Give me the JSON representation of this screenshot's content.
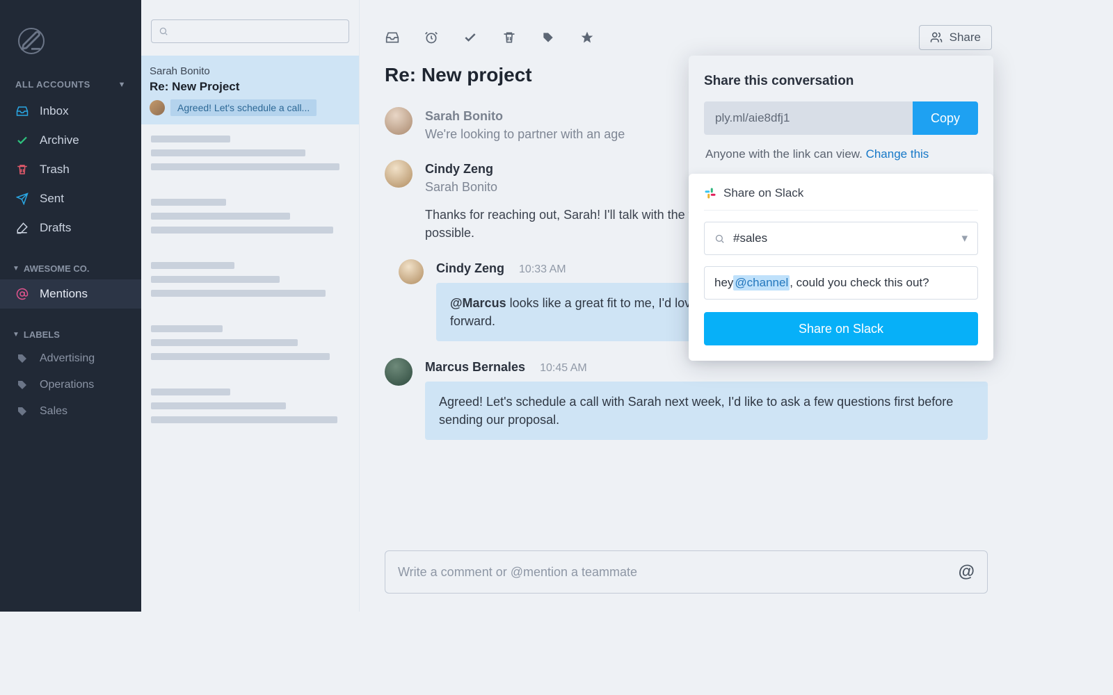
{
  "sidebar": {
    "accounts_header": "ALL ACCOUNTS",
    "nav": {
      "inbox": "Inbox",
      "archive": "Archive",
      "trash": "Trash",
      "sent": "Sent",
      "drafts": "Drafts"
    },
    "team_header": "AWESOME CO.",
    "mentions_label": "Mentions",
    "labels_header": "LABELS",
    "labels": [
      "Advertising",
      "Operations",
      "Sales"
    ]
  },
  "search": {
    "placeholder": ""
  },
  "list": {
    "selected": {
      "from": "Sarah Bonito",
      "subject": "Re:  New Project",
      "chip": "Agreed! Let's schedule a call..."
    }
  },
  "toolbar": {
    "share_label": "Share"
  },
  "thread": {
    "title": "Re: New project",
    "m1": {
      "name": "Sarah Bonito",
      "preview": "We're looking to partner with an age"
    },
    "m2": {
      "name": "Cindy Zeng",
      "cc": "Sarah Bonito",
      "body": "Thanks for reaching out, Sarah! I'll talk with the team and send over a timeline and pricing as soon as possible."
    },
    "m3": {
      "name": "Cindy Zeng",
      "time": "10:33 AM",
      "mention": "@Marcus",
      "rest": " looks like a great fit to me, I'd love to hear more & see an outline before moving forward."
    },
    "m4": {
      "name": "Marcus Bernales",
      "time": "10:45 AM",
      "body": "Agreed! Let's schedule a call with Sarah next week, I'd like to ask a few questions first before sending our proposal."
    },
    "compose_placeholder": "Write a comment or @mention a teammate"
  },
  "share": {
    "title": "Share this conversation",
    "link": "ply.ml/aie8dfj1",
    "copy_label": "Copy",
    "perm_text": "Anyone with the link can view. ",
    "perm_link": "Change this",
    "slack_header": "Share on Slack",
    "channel": "#sales",
    "msg_prefix": "hey ",
    "msg_mention": "@channel",
    "msg_suffix": ", could you check this out?",
    "button_label": "Share on Slack"
  }
}
